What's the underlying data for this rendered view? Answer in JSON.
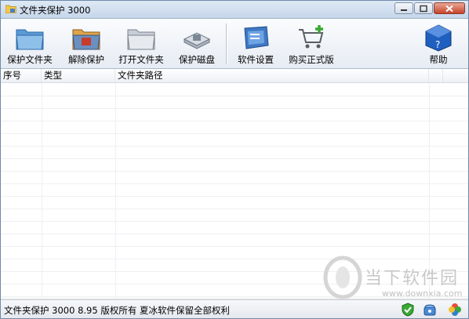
{
  "window": {
    "title": "文件夹保护 3000"
  },
  "toolbar": {
    "protect_folder": "保护文件夹",
    "unprotect": "解除保护",
    "open_folder": "打开文件夹",
    "protect_disk": "保护磁盘",
    "settings": "软件设置",
    "buy": "购买正式版",
    "help": "帮助"
  },
  "table": {
    "columns": [
      "序号",
      "类型",
      "文件夹路径"
    ]
  },
  "statusbar": {
    "text": "文件夹保护 3000 8.95 版权所有 夏冰软件保留全部权利"
  },
  "watermark": {
    "brand": "当下软件园",
    "url": "www.downxia.com"
  },
  "colors": {
    "folder_blue": "#5b9bd5",
    "cart_green": "#3aa935",
    "help_blue": "#1f5fbf"
  }
}
